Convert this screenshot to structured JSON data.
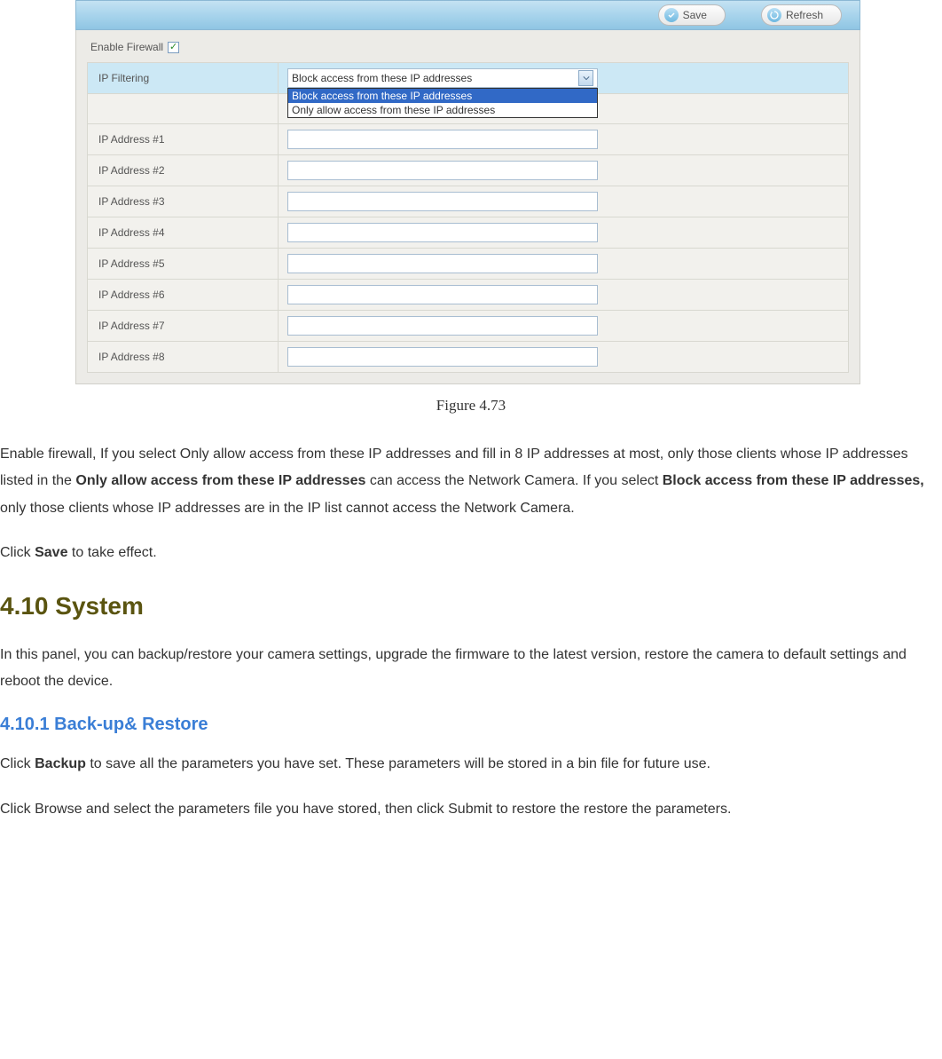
{
  "screenshot": {
    "header": {
      "save_label": "Save",
      "refresh_label": "Refresh",
      "save_icon": "save-icon",
      "refresh_icon": "refresh-icon"
    },
    "enable_firewall_label": "Enable Firewall",
    "enable_firewall_checked": true,
    "ip_filtering_label": "IP Filtering",
    "dropdown": {
      "selected": "Block access from these IP addresses",
      "options": [
        "Block access from these IP addresses",
        "Only allow access from these IP addresses"
      ],
      "selected_index": 0
    },
    "ip_rows": [
      {
        "label": "IP Address #1",
        "value": ""
      },
      {
        "label": "IP Address #2",
        "value": ""
      },
      {
        "label": "IP Address #3",
        "value": ""
      },
      {
        "label": "IP Address #4",
        "value": ""
      },
      {
        "label": "IP Address #5",
        "value": ""
      },
      {
        "label": "IP Address #6",
        "value": ""
      },
      {
        "label": "IP Address #7",
        "value": ""
      },
      {
        "label": "IP Address #8",
        "value": ""
      }
    ]
  },
  "figure_caption": "Figure 4.73",
  "doc": {
    "para1_pre": "Enable firewall, If you select Only allow access from these IP addresses and fill in 8 IP addresses at most, only those clients whose IP addresses listed in the ",
    "para1_b1": "Only allow access from these IP addresses",
    "para1_mid": " can access the Network Camera. If you select ",
    "para1_b2": "Block access from these IP addresses,",
    "para1_post": " only those clients whose IP addresses are in the IP list cannot access the Network Camera.",
    "para2_pre": "Click ",
    "para2_b": "Save",
    "para2_post": " to take effect.",
    "h1": "4.10    System",
    "para3": "In this panel, you can backup/restore your camera settings, upgrade the firmware to the latest version, restore the camera to default settings and reboot the device.",
    "h2": "4.10.1    Back-up& Restore",
    "para4_pre": "Click ",
    "para4_b": "Backup",
    "para4_post": " to save all the parameters you have set. These parameters will be stored in a bin file for future use.",
    "para5": "Click Browse and select the parameters file you have stored, then click Submit to restore the restore the parameters."
  }
}
